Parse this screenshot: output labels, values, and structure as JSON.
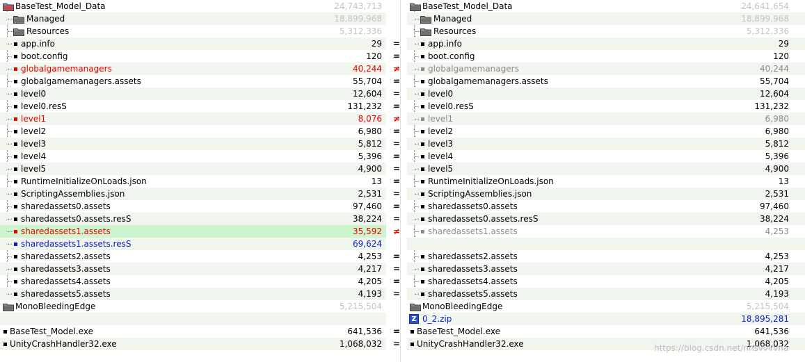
{
  "left": {
    "root": {
      "name": "BaseTest_Model_Data",
      "size": "24,743,713"
    },
    "rows": [
      {
        "name": "Managed",
        "size": "18,899,968",
        "type": "folder",
        "depth": 1,
        "status": "normal"
      },
      {
        "name": "Resources",
        "size": "5,312,336",
        "type": "folder",
        "depth": 1,
        "status": "normal"
      },
      {
        "name": "app.info",
        "size": "29",
        "type": "file",
        "depth": 1,
        "status": "normal"
      },
      {
        "name": "boot.config",
        "size": "120",
        "type": "file",
        "depth": 1,
        "status": "normal"
      },
      {
        "name": "globalgamemanagers",
        "size": "40,244",
        "type": "file",
        "depth": 1,
        "status": "different"
      },
      {
        "name": "globalgamemanagers.assets",
        "size": "55,704",
        "type": "file",
        "depth": 1,
        "status": "normal"
      },
      {
        "name": "level0",
        "size": "12,604",
        "type": "file",
        "depth": 1,
        "status": "normal"
      },
      {
        "name": "level0.resS",
        "size": "131,232",
        "type": "file",
        "depth": 1,
        "status": "normal"
      },
      {
        "name": "level1",
        "size": "8,076",
        "type": "file",
        "depth": 1,
        "status": "different"
      },
      {
        "name": "level2",
        "size": "6,980",
        "type": "file",
        "depth": 1,
        "status": "normal"
      },
      {
        "name": "level3",
        "size": "5,812",
        "type": "file",
        "depth": 1,
        "status": "normal"
      },
      {
        "name": "level4",
        "size": "5,396",
        "type": "file",
        "depth": 1,
        "status": "normal"
      },
      {
        "name": "level5",
        "size": "4,900",
        "type": "file",
        "depth": 1,
        "status": "normal"
      },
      {
        "name": "RuntimeInitializeOnLoads.json",
        "size": "13",
        "type": "file",
        "depth": 1,
        "status": "normal"
      },
      {
        "name": "ScriptingAssemblies.json",
        "size": "2,531",
        "type": "file",
        "depth": 1,
        "status": "normal"
      },
      {
        "name": "sharedassets0.assets",
        "size": "97,460",
        "type": "file",
        "depth": 1,
        "status": "normal"
      },
      {
        "name": "sharedassets0.assets.resS",
        "size": "38,224",
        "type": "file",
        "depth": 1,
        "status": "normal"
      },
      {
        "name": "sharedassets1.assets",
        "size": "35,592",
        "type": "file",
        "depth": 1,
        "status": "different"
      },
      {
        "name": "sharedassets1.assets.resS",
        "size": "69,624",
        "type": "file",
        "depth": 1,
        "status": "orphan"
      },
      {
        "name": "sharedassets2.assets",
        "size": "4,253",
        "type": "file",
        "depth": 1,
        "status": "normal"
      },
      {
        "name": "sharedassets3.assets",
        "size": "4,217",
        "type": "file",
        "depth": 1,
        "status": "normal"
      },
      {
        "name": "sharedassets4.assets",
        "size": "4,205",
        "type": "file",
        "depth": 1,
        "status": "normal"
      },
      {
        "name": "sharedassets5.assets",
        "size": "4,193",
        "type": "file",
        "depth": 1,
        "status": "normal"
      },
      {
        "name": "MonoBleedingEdge",
        "size": "5,215,504",
        "type": "folder",
        "depth": 0,
        "status": "normal"
      },
      {
        "name": "",
        "size": "",
        "type": "empty",
        "depth": 0,
        "status": "normal"
      },
      {
        "name": "BaseTest_Model.exe",
        "size": "641,536",
        "type": "file",
        "depth": 0,
        "status": "normal"
      },
      {
        "name": "UnityCrashHandler32.exe",
        "size": "1,068,032",
        "type": "file",
        "depth": 0,
        "status": "normal"
      }
    ]
  },
  "right": {
    "root": {
      "name": "BaseTest_Model_Data",
      "size": "24,641,654"
    },
    "rows": [
      {
        "name": "Managed",
        "size": "18,899,968",
        "type": "folder",
        "depth": 1,
        "status": "normal"
      },
      {
        "name": "Resources",
        "size": "5,312,336",
        "type": "folder",
        "depth": 1,
        "status": "normal"
      },
      {
        "name": "app.info",
        "size": "29",
        "type": "file",
        "depth": 1,
        "status": "normal"
      },
      {
        "name": "boot.config",
        "size": "120",
        "type": "file",
        "depth": 1,
        "status": "normal"
      },
      {
        "name": "globalgamemanagers",
        "size": "40,244",
        "type": "file",
        "depth": 1,
        "status": "older"
      },
      {
        "name": "globalgamemanagers.assets",
        "size": "55,704",
        "type": "file",
        "depth": 1,
        "status": "normal"
      },
      {
        "name": "level0",
        "size": "12,604",
        "type": "file",
        "depth": 1,
        "status": "normal"
      },
      {
        "name": "level0.resS",
        "size": "131,232",
        "type": "file",
        "depth": 1,
        "status": "normal"
      },
      {
        "name": "level1",
        "size": "6,980",
        "type": "file",
        "depth": 1,
        "status": "older"
      },
      {
        "name": "level2",
        "size": "6,980",
        "type": "file",
        "depth": 1,
        "status": "normal"
      },
      {
        "name": "level3",
        "size": "5,812",
        "type": "file",
        "depth": 1,
        "status": "normal"
      },
      {
        "name": "level4",
        "size": "5,396",
        "type": "file",
        "depth": 1,
        "status": "normal"
      },
      {
        "name": "level5",
        "size": "4,900",
        "type": "file",
        "depth": 1,
        "status": "normal"
      },
      {
        "name": "RuntimeInitializeOnLoads.json",
        "size": "13",
        "type": "file",
        "depth": 1,
        "status": "normal"
      },
      {
        "name": "ScriptingAssemblies.json",
        "size": "2,531",
        "type": "file",
        "depth": 1,
        "status": "normal"
      },
      {
        "name": "sharedassets0.assets",
        "size": "97,460",
        "type": "file",
        "depth": 1,
        "status": "normal"
      },
      {
        "name": "sharedassets0.assets.resS",
        "size": "38,224",
        "type": "file",
        "depth": 1,
        "status": "normal"
      },
      {
        "name": "sharedassets1.assets",
        "size": "4,253",
        "type": "file",
        "depth": 1,
        "status": "older"
      },
      {
        "name": "",
        "size": "",
        "type": "empty",
        "depth": 1,
        "status": "normal"
      },
      {
        "name": "sharedassets2.assets",
        "size": "4,253",
        "type": "file",
        "depth": 1,
        "status": "normal"
      },
      {
        "name": "sharedassets3.assets",
        "size": "4,217",
        "type": "file",
        "depth": 1,
        "status": "normal"
      },
      {
        "name": "sharedassets4.assets",
        "size": "4,205",
        "type": "file",
        "depth": 1,
        "status": "normal"
      },
      {
        "name": "sharedassets5.assets",
        "size": "4,193",
        "type": "file",
        "depth": 1,
        "status": "normal"
      },
      {
        "name": "MonoBleedingEdge",
        "size": "5,215,504",
        "type": "folder",
        "depth": 0,
        "status": "normal"
      },
      {
        "name": "0_2.zip",
        "size": "18,895,281",
        "type": "zip",
        "depth": 0,
        "status": "orphan"
      },
      {
        "name": "BaseTest_Model.exe",
        "size": "641,536",
        "type": "file",
        "depth": 0,
        "status": "normal"
      },
      {
        "name": "UnityCrashHandler32.exe",
        "size": "1,068,032",
        "type": "file",
        "depth": 0,
        "status": "normal"
      }
    ]
  },
  "gutter": [
    "",
    "",
    "",
    "=",
    "=",
    "≠",
    "=",
    "=",
    "=",
    "≠",
    "=",
    "=",
    "=",
    "=",
    "=",
    "=",
    "=",
    "=",
    "≠",
    "",
    "=",
    "=",
    "=",
    "=",
    "",
    "",
    "=",
    "="
  ],
  "watermark": "https://blog.csdn.net/nnsvvvvna",
  "colors": {
    "different": "#ea0000",
    "orphan": "#0a1ad0",
    "older": "#8b8b8b",
    "alt_row": "#f0f5ed",
    "highlight_row": "#cdf5cd"
  }
}
